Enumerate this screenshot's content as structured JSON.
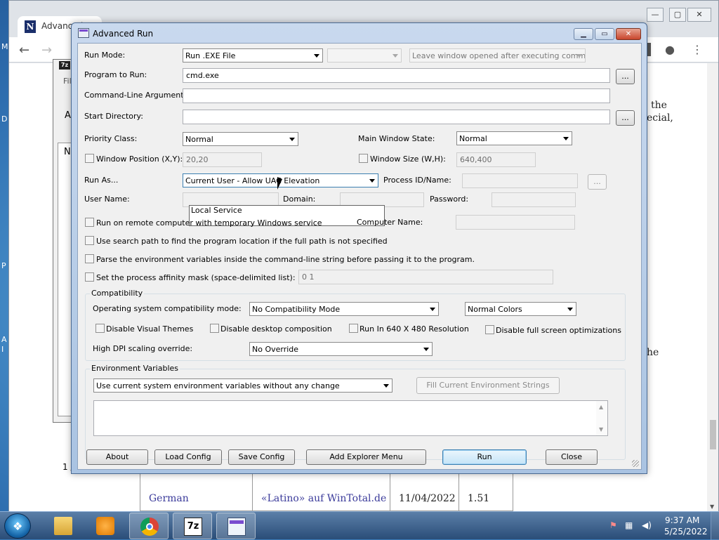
{
  "desktop": {
    "edge_labels": [
      "M",
      "D",
      "P",
      "A",
      "I"
    ]
  },
  "browser": {
    "tab_title": "Advanced",
    "tab_icon_letter": "N",
    "page_snippets": [
      "the",
      "ecial,",
      "he"
    ],
    "table_row": [
      "German",
      "«Latino» auf WinTotal.de",
      "11/04/2022",
      "1.51"
    ]
  },
  "sevenzip": {
    "title_icon": "7z",
    "menu_snippet": "Fil",
    "letters": [
      "A",
      "N"
    ],
    "status": "1 /"
  },
  "dialog": {
    "title": "Advanced Run",
    "labels": {
      "run_mode": "Run Mode:",
      "program": "Program to Run:",
      "cmd_args": "Command-Line Arguments:",
      "start_dir": "Start Directory:",
      "priority": "Priority Class:",
      "main_state": "Main Window State:",
      "window_pos": "Window Position (X,Y):",
      "window_size": "Window Size (W,H):",
      "run_as": "Run As...",
      "process_id": "Process ID/Name:",
      "user_name": "User Name:",
      "domain": "Domain:",
      "password": "Password:",
      "computer_name": "Computer Name:",
      "os_compat": "Operating system compatibility mode:",
      "high_dpi": "High DPI scaling override:"
    },
    "values": {
      "run_mode": "Run .EXE File",
      "run_mode_extra": "",
      "after_exec": "Leave window opened after executing command",
      "program": "cmd.exe",
      "cmd_args": "",
      "start_dir": "",
      "priority": "Normal",
      "main_state": "Normal",
      "window_pos": "20,20",
      "window_size": "640,400",
      "run_as": "Current User - Allow UAC Elevation",
      "process_id": "",
      "affinity": "0 1",
      "os_compat": "No Compatibility Mode",
      "colors": "Normal Colors",
      "high_dpi": "No Override",
      "env_mode": "Use current system environment variables without any change"
    },
    "run_as_dropdown": [
      "Local Service"
    ],
    "checkboxes": {
      "remote": "Run on remote computer with temporary Windows service",
      "search_path": "Use search path to find the program location if the full path is not specified",
      "parse_env": "Parse the environment variables inside the command-line string before passing it to the program.",
      "affinity": "Set the process affinity mask (space-delimited list):",
      "disable_themes": "Disable Visual Themes",
      "disable_composition": "Disable desktop composition",
      "run_640": "Run In 640 X 480 Resolution",
      "disable_fullscreen": "Disable full screen optimizations"
    },
    "groups": {
      "compat": "Compatibility",
      "env": "Environment Variables"
    },
    "buttons": {
      "browse": "...",
      "fill_env": "Fill Current Environment Strings",
      "about": "About",
      "load_config": "Load Config",
      "save_config": "Save Config",
      "add_explorer": "Add Explorer Menu",
      "run": "Run",
      "close": "Close"
    }
  },
  "taskbar": {
    "clock_time": "9:37 AM",
    "clock_date": "5/25/2022",
    "apps": [
      "windows-explorer",
      "media-player",
      "chrome",
      "7-zip",
      "advanced-run"
    ]
  }
}
